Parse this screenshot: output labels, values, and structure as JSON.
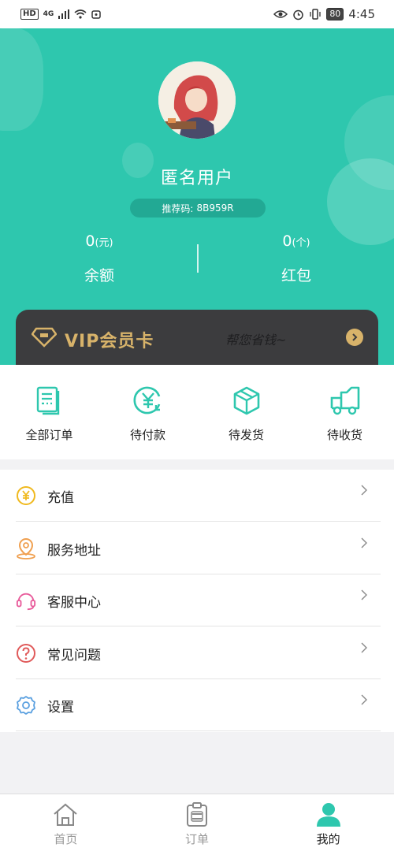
{
  "status_bar": {
    "hd": "HD",
    "net": "4G",
    "battery": "80",
    "time": "4:45"
  },
  "profile": {
    "username": "匿名用户",
    "referral_label": "推荐码:",
    "referral_code": "8B959R",
    "balance": {
      "value": "0",
      "unit": "(元)",
      "label": "余额"
    },
    "redpacket": {
      "value": "0",
      "unit": "(个)",
      "label": "红包"
    }
  },
  "vip": {
    "title": "VIP会员卡",
    "slogan": "帮您省钱~"
  },
  "orders": [
    {
      "label": "全部订单",
      "icon": "orders-list-icon"
    },
    {
      "label": "待付款",
      "icon": "yuan-pay-icon"
    },
    {
      "label": "待发货",
      "icon": "package-box-icon"
    },
    {
      "label": "待收货",
      "icon": "delivery-truck-icon"
    }
  ],
  "menu": [
    {
      "label": "充值",
      "icon": "recharge-coin-icon",
      "color": "#f0b91e"
    },
    {
      "label": "服务地址",
      "icon": "location-pin-icon",
      "color": "#f0a050"
    },
    {
      "label": "客服中心",
      "icon": "headset-icon",
      "color": "#e85a9a"
    },
    {
      "label": "常见问题",
      "icon": "question-icon",
      "color": "#e05a5a"
    },
    {
      "label": "设置",
      "icon": "gear-icon",
      "color": "#5aa0e0"
    }
  ],
  "tabs": [
    {
      "label": "首页",
      "icon": "home-icon"
    },
    {
      "label": "订单",
      "icon": "order-clipboard-icon"
    },
    {
      "label": "我的",
      "icon": "user-icon"
    }
  ],
  "colors": {
    "primary": "#2ec7ae",
    "vip_gold": "#d8b36a",
    "vip_bg": "#3c3c3e"
  }
}
